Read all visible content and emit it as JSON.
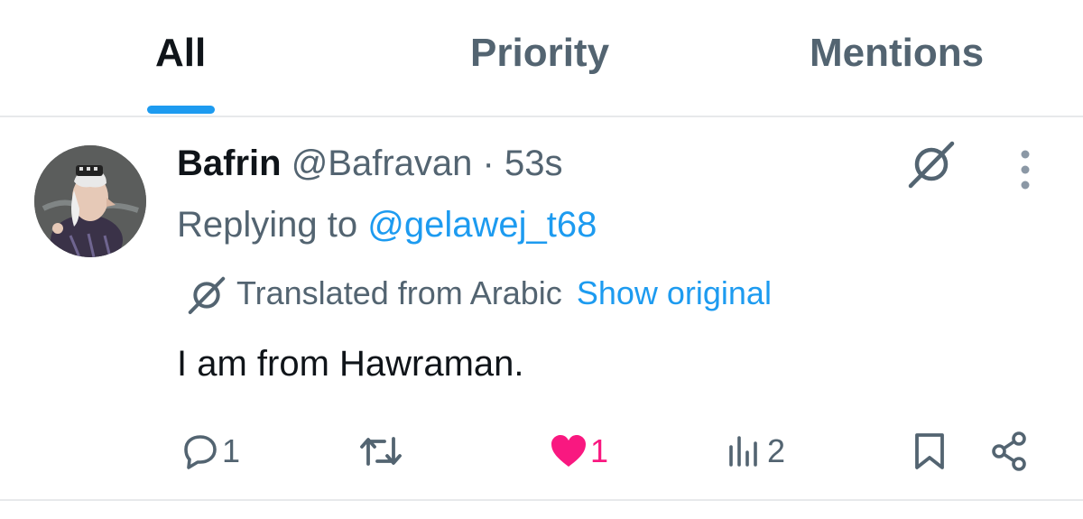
{
  "tabs": [
    {
      "label": "All",
      "active": true
    },
    {
      "label": "Priority",
      "active": false
    },
    {
      "label": "Mentions",
      "active": false
    }
  ],
  "tweet": {
    "display_name": "Bafrin",
    "handle": "@Bafravan",
    "separator": "·",
    "time": "53s",
    "replying_to_prefix": "Replying to",
    "replying_to_handle": "@gelawej_t68",
    "translation_note": "Translated from Arabic",
    "show_original_label": "Show original",
    "text": "I am from Hawraman."
  },
  "actions": {
    "replies": "1",
    "likes": "1",
    "views": "2"
  },
  "colors": {
    "accent": "#1d9bf0",
    "like": "#f91880",
    "muted": "#536471",
    "text": "#0f1419"
  },
  "icons": [
    "translate-icon",
    "more-icon",
    "reply-icon",
    "retweet-icon",
    "like-icon",
    "views-icon",
    "bookmark-icon",
    "share-icon"
  ]
}
